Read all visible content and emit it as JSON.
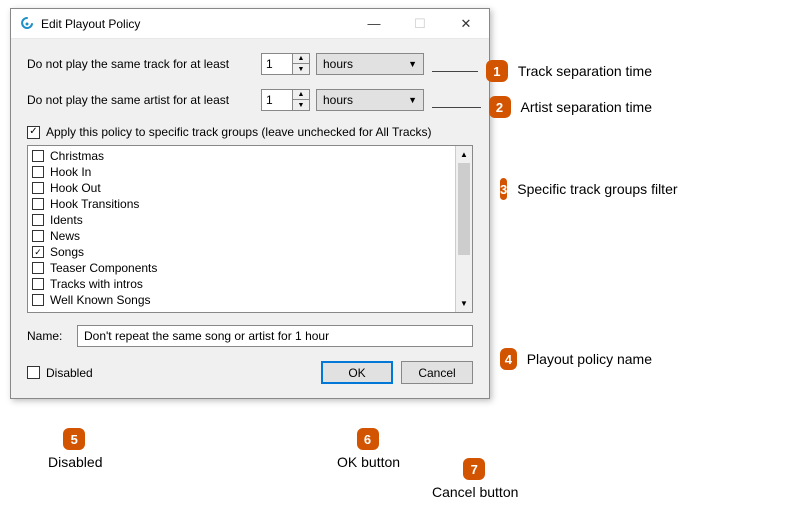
{
  "window": {
    "title": "Edit Playout Policy",
    "minimize_glyph": "—",
    "maximize_glyph": "☐",
    "close_glyph": "✕"
  },
  "track_row": {
    "label": "Do not play the same track for at least",
    "value": "1",
    "unit": "hours"
  },
  "artist_row": {
    "label": "Do not play the same artist for at least",
    "value": "1",
    "unit": "hours"
  },
  "apply_groups": {
    "checked": true,
    "label": "Apply this policy to specific track groups (leave unchecked for All Tracks)"
  },
  "groups": [
    {
      "label": "Christmas",
      "checked": false
    },
    {
      "label": "Hook In",
      "checked": false
    },
    {
      "label": "Hook Out",
      "checked": false
    },
    {
      "label": "Hook Transitions",
      "checked": false
    },
    {
      "label": "Idents",
      "checked": false
    },
    {
      "label": "News",
      "checked": false
    },
    {
      "label": "Songs",
      "checked": true
    },
    {
      "label": "Teaser Components",
      "checked": false
    },
    {
      "label": "Tracks with intros",
      "checked": false
    },
    {
      "label": "Well Known Songs",
      "checked": false
    }
  ],
  "name_row": {
    "label": "Name:",
    "value": "Don't repeat the same song or artist for 1 hour"
  },
  "disabled_check": {
    "checked": false,
    "label": "Disabled"
  },
  "buttons": {
    "ok": "OK",
    "cancel": "Cancel"
  },
  "callouts": {
    "c1": {
      "num": "1",
      "label": "Track separation time"
    },
    "c2": {
      "num": "2",
      "label": "Artist separation time"
    },
    "c3": {
      "num": "3",
      "label": "Specific track groups filter"
    },
    "c4": {
      "num": "4",
      "label": "Playout policy name"
    },
    "c5": {
      "num": "5",
      "label": "Disabled"
    },
    "c6": {
      "num": "6",
      "label": "OK button"
    },
    "c7": {
      "num": "7",
      "label": "Cancel button"
    }
  }
}
